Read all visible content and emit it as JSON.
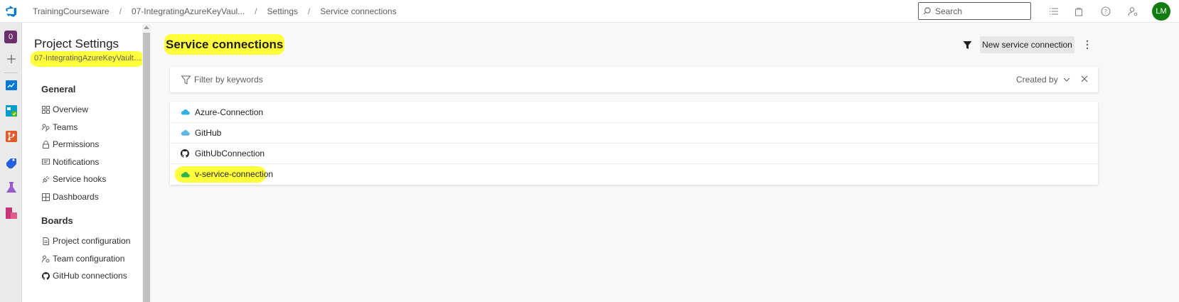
{
  "header": {
    "breadcrumbs": [
      "TrainingCourseware",
      "07-IntegratingAzureKeyVaul...",
      "Settings",
      "Service connections"
    ],
    "search_placeholder": "Search",
    "avatar_initials": "LM"
  },
  "rail": {
    "project_badge": "0"
  },
  "nav": {
    "title": "Project Settings",
    "project_name": "07-IntegratingAzureKeyVaultw...",
    "sections": [
      {
        "heading": "General",
        "items": [
          "Overview",
          "Teams",
          "Permissions",
          "Notifications",
          "Service hooks",
          "Dashboards"
        ]
      },
      {
        "heading": "Boards",
        "items": [
          "Project configuration",
          "Team configuration",
          "GitHub connections"
        ]
      }
    ]
  },
  "main": {
    "title": "Service connections",
    "new_button": "New service connection",
    "filter_placeholder": "Filter by keywords",
    "created_by": "Created by",
    "connections": [
      {
        "name": "Azure-Connection",
        "icon": "azure-cloud-icon"
      },
      {
        "name": "GitHub",
        "icon": "azure-cloud-icon"
      },
      {
        "name": "GithUbConnection",
        "icon": "github-icon"
      },
      {
        "name": "v-service-connection",
        "icon": "azure-cloud-green-icon"
      }
    ]
  },
  "colors": {
    "highlight": "#ffff3b",
    "accent": "#0078d4",
    "avatar": "#107c10"
  }
}
